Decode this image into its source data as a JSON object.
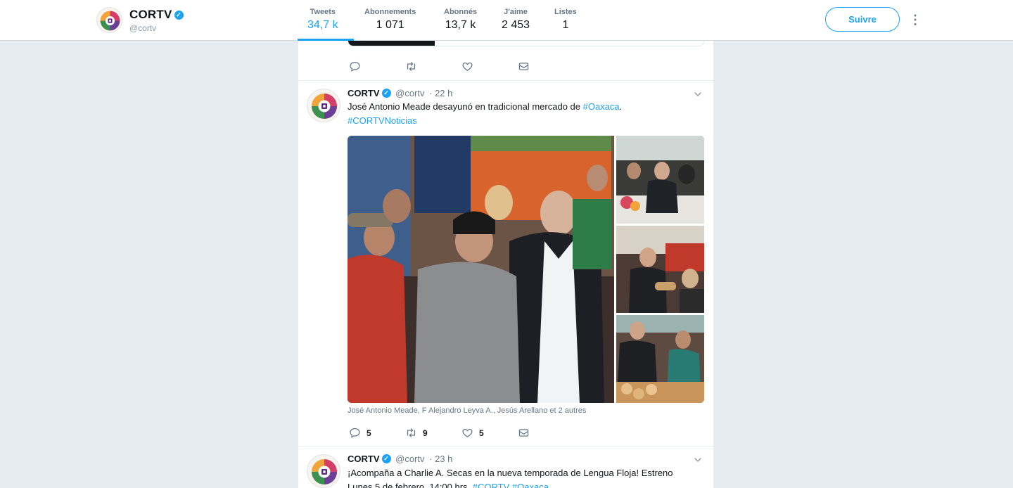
{
  "profile": {
    "name": "CORTV",
    "handle": "@cortv",
    "follow_label": "Suivre"
  },
  "stats": [
    {
      "label": "Tweets",
      "value": "34,7 k"
    },
    {
      "label": "Abonnements",
      "value": "1 071"
    },
    {
      "label": "Abonnés",
      "value": "13,7 k"
    },
    {
      "label": "J'aime",
      "value": "2 453"
    },
    {
      "label": "Listes",
      "value": "1"
    }
  ],
  "tweets": [
    {
      "name": "CORTV",
      "handle": "@cortv",
      "time": "· 22 h",
      "text": "José Antonio Meade desayunó en tradicional mercado de ",
      "link1": "#Oaxaca",
      "text_end": ".",
      "link2": "#CORTVNoticias",
      "tagged": "José Antonio Meade, F Alejandro Leyva A., Jesús Arellano et 2 autres",
      "replies": "5",
      "retweets": "9",
      "likes": "5"
    },
    {
      "name": "CORTV",
      "handle": "@cortv",
      "time": "· 23 h",
      "text": "¡Acompaña a Charlie A. Secas en la nueva temporada de Lengua Floja! Estreno",
      "text2": "Lunes 5 de febrero, 14:00 hrs. ",
      "link1": "#CORTV",
      "link2": "#Oaxaca"
    }
  ],
  "colors": {
    "accent": "#1da1f2",
    "background": "#e6ecf0",
    "muted": "#657786"
  },
  "icons": [
    "verified-icon",
    "more-icon",
    "reply-icon",
    "retweet-icon",
    "like-icon",
    "message-icon",
    "caret-down-icon"
  ]
}
